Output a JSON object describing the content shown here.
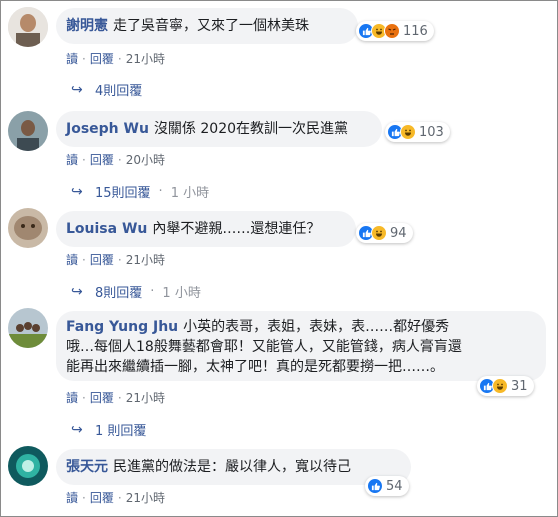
{
  "comments": [
    {
      "author": "謝明憲",
      "text": "走了吳音寧，又來了一個林美珠",
      "reactions": [
        "like",
        "haha",
        "angry"
      ],
      "reaction_count": "116",
      "action_read": "讀",
      "action_reply": "回覆",
      "time": "21小時",
      "replies_label": "4則回覆",
      "replies_time": ""
    },
    {
      "author": "Joseph Wu",
      "text": "沒關係 2020在教訓一次民進黨",
      "reactions": [
        "like",
        "haha"
      ],
      "reaction_count": "103",
      "action_read": "讀",
      "action_reply": "回覆",
      "time": "20小時",
      "replies_label": "15則回覆",
      "replies_time": "1 小時"
    },
    {
      "author": "Louisa Wu",
      "text": "內舉不避親……還想連任？",
      "reactions": [
        "like",
        "haha"
      ],
      "reaction_count": "94",
      "action_read": "讀",
      "action_reply": "回覆",
      "time": "21小時",
      "replies_label": "8則回覆",
      "replies_time": "1 小時"
    },
    {
      "author": "Fang Yung Jhu",
      "text_lines": [
        "小英的表哥，表姐，表妹，表……都好優秀",
        "哦…每個人18般舞藝都會耶！又能管人，又能管錢，病人膏肓還",
        "能再出來繼續插一腳，太神了吧！真的是死都要撈一把……。"
      ],
      "reactions": [
        "like",
        "haha"
      ],
      "reaction_count": "31",
      "action_read": "讀",
      "action_reply": "回覆",
      "time": "21小時",
      "replies_label": "1 則回覆",
      "replies_time": ""
    },
    {
      "author": "張天元",
      "text": "民進黨的做法是：嚴以律人，寬以待己",
      "reactions": [
        "like"
      ],
      "reaction_count": "54",
      "action_read": "讀",
      "action_reply": "回覆",
      "time": "21小時"
    }
  ],
  "colors": {
    "author": "#385898",
    "bubble": "#f2f3f5",
    "like": "#1877f2",
    "haha": "#f7b928",
    "angry": "#e9710f"
  }
}
